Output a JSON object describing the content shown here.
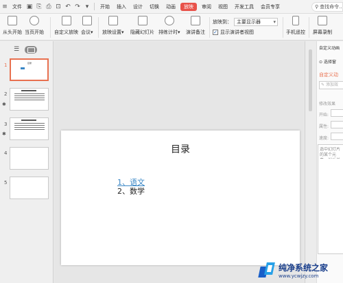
{
  "menubar": {
    "file": "文件",
    "tabs": [
      "开始",
      "插入",
      "设计",
      "切换",
      "动画",
      "放映",
      "审阅",
      "视图",
      "开发工具",
      "会员专享"
    ],
    "active_tab": "放映",
    "search_placeholder": "查找命令..."
  },
  "ribbon": {
    "from_start": "从头开始",
    "from_current": "当页开始",
    "custom_show": "自定义放映",
    "meeting": "会议",
    "show_settings": "放映设置",
    "hide_slide": "隐藏幻灯片",
    "rehearse": "排练计时",
    "speaker_notes": "演讲备注",
    "show_on_label": "放映到：",
    "show_on_value": "主要显示器",
    "presenter_view": "显示演讲者视图",
    "presenter_view_checked": true,
    "phone_remote": "手机遥控",
    "screen_record": "屏幕录制"
  },
  "thumbnails": {
    "slides": [
      {
        "num": "1",
        "title": "目录",
        "active": true,
        "star": false
      },
      {
        "num": "2",
        "title": "",
        "active": false,
        "star": true
      },
      {
        "num": "3",
        "title": "",
        "active": false,
        "star": true
      },
      {
        "num": "4",
        "title": "",
        "active": false,
        "star": false
      },
      {
        "num": "5",
        "title": "",
        "active": false,
        "star": false
      }
    ]
  },
  "slide": {
    "title": "目录",
    "item1": "1、语文",
    "item2": "2、数学"
  },
  "right_panel": {
    "title": "自定义动画",
    "select_pane": "选择窗",
    "custom_anim": "自定义动",
    "add_effect": "添加效",
    "modify_effect": "修改效果",
    "start": "开始:",
    "property": "属性:",
    "speed": "速度:",
    "hint": "选中幻灯片的某个元素，然后单击\"添加效果\"添加动画。"
  },
  "watermark": {
    "line1": "纯净系统之家",
    "line2": "www.ycwjzy.com"
  },
  "colors": {
    "accent": "#e8524a",
    "link": "#3a87c6"
  }
}
